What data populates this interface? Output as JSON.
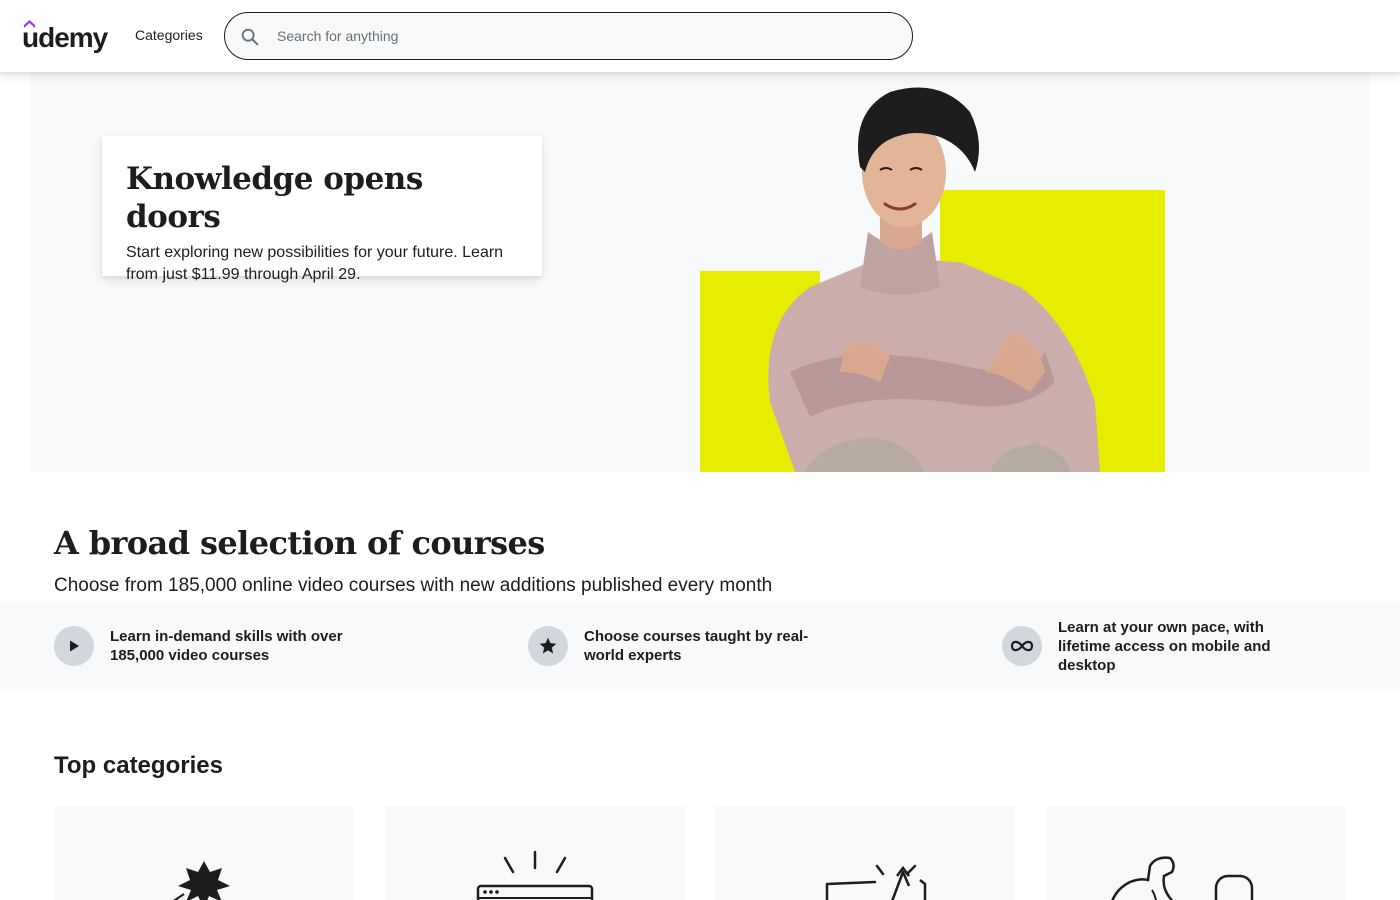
{
  "header": {
    "logo_text": "udemy",
    "categories_label": "Categories",
    "search_placeholder": "Search for anything"
  },
  "hero": {
    "title": "Knowledge opens doors",
    "text": "Start exploring new possibilities for your future. Learn from just $11.99 through April 29.",
    "accent_color": "#e8ed00"
  },
  "selection": {
    "title": "A broad selection of courses",
    "subtitle": "Choose from 185,000 online video courses with new additions published every month"
  },
  "features": [
    {
      "icon": "play-icon",
      "text": "Learn in-demand skills with over 185,000 video courses"
    },
    {
      "icon": "star-icon",
      "text": "Choose courses taught by real-world experts"
    },
    {
      "icon": "infinity-icon",
      "text": "Learn at your own pace, with lifetime access on mobile and desktop"
    }
  ],
  "top_categories": {
    "title": "Top categories",
    "cards": [
      {
        "icon": "design-illustration-icon"
      },
      {
        "icon": "development-illustration-icon"
      },
      {
        "icon": "marketing-illustration-icon"
      },
      {
        "icon": "it-software-illustration-icon"
      }
    ]
  },
  "colors": {
    "brand_purple": "#a435f0",
    "text": "#1c1d1f",
    "panel_bg": "#f7f9fa"
  }
}
